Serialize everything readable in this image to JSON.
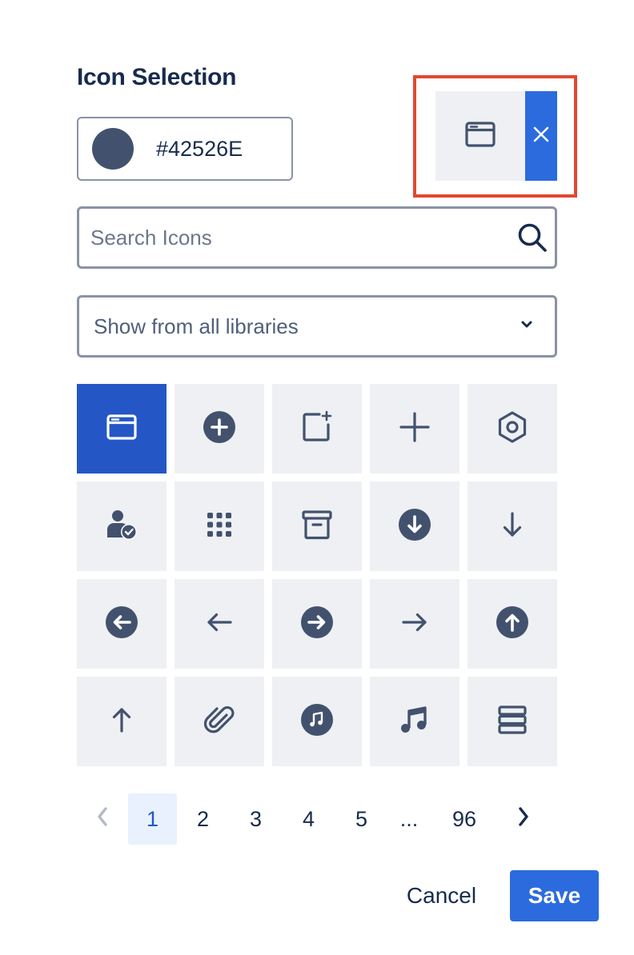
{
  "dialog": {
    "title": "Icon Selection"
  },
  "color": {
    "value": "#42526E",
    "swatch": "#42526E"
  },
  "preview": {
    "icon": "window-icon",
    "clear_icon": "close-icon"
  },
  "search": {
    "placeholder": "Search Icons",
    "value": ""
  },
  "library_select": {
    "value": "Show from all libraries"
  },
  "icons": [
    {
      "name": "window-icon",
      "selected": true
    },
    {
      "name": "plus-circle-icon",
      "selected": false
    },
    {
      "name": "add-page-icon",
      "selected": false
    },
    {
      "name": "plus-icon",
      "selected": false
    },
    {
      "name": "hexagon-icon",
      "selected": false
    },
    {
      "name": "user-check-icon",
      "selected": false
    },
    {
      "name": "grid-dots-icon",
      "selected": false
    },
    {
      "name": "archive-icon",
      "selected": false
    },
    {
      "name": "arrow-down-circle-icon",
      "selected": false
    },
    {
      "name": "arrow-down-icon",
      "selected": false
    },
    {
      "name": "arrow-left-circle-icon",
      "selected": false
    },
    {
      "name": "arrow-left-icon",
      "selected": false
    },
    {
      "name": "arrow-right-circle-icon",
      "selected": false
    },
    {
      "name": "arrow-right-icon",
      "selected": false
    },
    {
      "name": "arrow-up-circle-icon",
      "selected": false
    },
    {
      "name": "arrow-up-icon",
      "selected": false
    },
    {
      "name": "paperclip-icon",
      "selected": false
    },
    {
      "name": "music-circle-icon",
      "selected": false
    },
    {
      "name": "music-note-icon",
      "selected": false
    },
    {
      "name": "stack-icon",
      "selected": false
    }
  ],
  "pagination": {
    "prev_icon": "chevron-left-icon",
    "next_icon": "chevron-right-icon",
    "current": "1",
    "pages": [
      "1",
      "2",
      "3",
      "4",
      "5",
      "...",
      "96"
    ]
  },
  "actions": {
    "cancel_label": "Cancel",
    "save_label": "Save"
  },
  "colors": {
    "accent": "#2B6BDD",
    "selected": "#2456C6",
    "icon": "#42526E",
    "highlight_border": "#E2482F",
    "tile": "#EFF0F3"
  }
}
